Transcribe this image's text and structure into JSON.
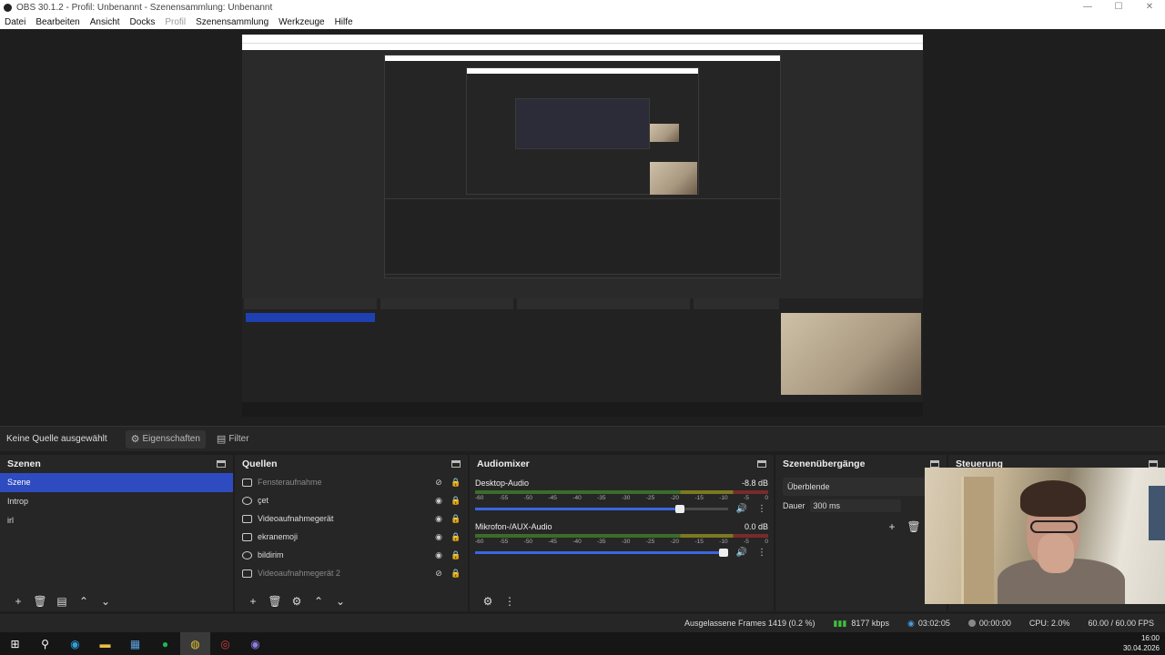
{
  "window": {
    "title": "OBS 30.1.2 - Profil: Unbenannt - Szenensammlung: Unbenannt",
    "controls": [
      "—",
      "☐",
      "✕"
    ]
  },
  "menu": {
    "items": [
      {
        "label": "Datei",
        "disabled": false
      },
      {
        "label": "Bearbeiten",
        "disabled": false
      },
      {
        "label": "Ansicht",
        "disabled": false
      },
      {
        "label": "Docks",
        "disabled": false
      },
      {
        "label": "Profil",
        "disabled": true
      },
      {
        "label": "Szenensammlung",
        "disabled": false
      },
      {
        "label": "Werkzeuge",
        "disabled": false
      },
      {
        "label": "Hilfe",
        "disabled": false
      }
    ]
  },
  "toolbar": {
    "no_source": "Keine Quelle ausgewählt",
    "properties_label": "Eigenschaften",
    "properties_icon": "gear-icon",
    "filter_label": "Filter",
    "filter_icon": "filter-icon"
  },
  "scenes": {
    "title": "Szenen",
    "items": [
      "Szene",
      "Introp",
      "irl"
    ],
    "selected": 0
  },
  "sources": {
    "title": "Quellen",
    "items": [
      {
        "name": "Fensteraufnahme",
        "icon": "window-icon",
        "visible": false
      },
      {
        "name": "çet",
        "icon": "globe-icon",
        "visible": true
      },
      {
        "name": "Videoaufnahmegerät",
        "icon": "camera-icon",
        "visible": true
      },
      {
        "name": "ekranemoji",
        "icon": "camera-icon",
        "visible": true
      },
      {
        "name": "bildirim",
        "icon": "globe-icon",
        "visible": true
      },
      {
        "name": "Videoaufnahmegerät 2",
        "icon": "camera-icon",
        "visible": false
      }
    ]
  },
  "mixer": {
    "title": "Audiomixer",
    "ticks": [
      "-60",
      "-55",
      "-50",
      "-45",
      "-40",
      "-35",
      "-30",
      "-25",
      "-20",
      "-15",
      "-10",
      "-5",
      "0"
    ],
    "channels": [
      {
        "name": "Desktop-Audio",
        "db": "-8.8 dB",
        "volume": 0.81
      },
      {
        "name": "Mikrofon-/AUX-Audio",
        "db": "0.0 dB",
        "volume": 1.0
      }
    ]
  },
  "transitions": {
    "title": "Szenenübergänge",
    "selected": "Überblende",
    "duration_label": "Dauer",
    "duration_value": "300 ms"
  },
  "controls_dock": {
    "title": "Steuerung"
  },
  "status": {
    "dropped_frames": "Ausgelassene Frames 1419 (0.2 %)",
    "bitrate": "8177 kbps",
    "stream_time": "03:02:05",
    "rec_time": "00:00:00",
    "cpu": "CPU: 2.0%",
    "fps": "60.00 / 60.00 FPS"
  },
  "taskbar": {
    "time": "16:00",
    "date": "30.04.2026",
    "apps": [
      "windows-icon",
      "search-icon",
      "edge-icon",
      "explorer-icon",
      "store-icon",
      "spotify-icon",
      "chrome-icon",
      "app-icon",
      "obs-icon"
    ],
    "active_index": 6
  }
}
